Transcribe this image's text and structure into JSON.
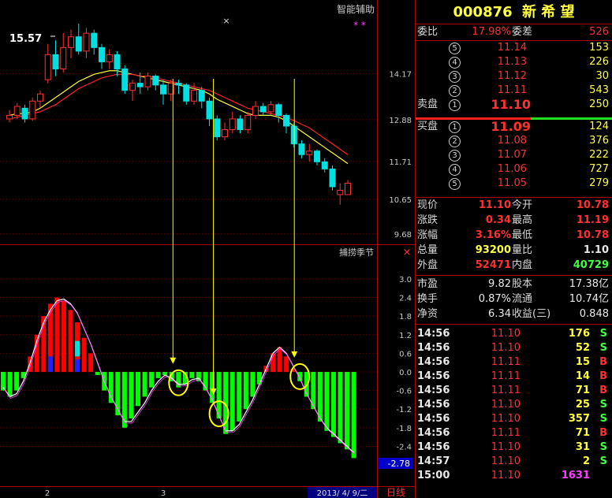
{
  "chart": {
    "indicator_title": "智能辅助",
    "sub_title": "捕捞季节",
    "high_marker": "15.57",
    "stars": "* *",
    "price_axis": [
      "14.17",
      "12.88",
      "11.71",
      "10.65",
      "9.68"
    ],
    "osc_axis": [
      "3.0",
      "2.4",
      "1.8",
      "1.2",
      "0.6",
      "0.0",
      "-0.6",
      "-1.2",
      "-1.8",
      "-2.4"
    ],
    "osc_current": "-2.78",
    "x_labels": [
      "2",
      "3"
    ],
    "date_label": "2013/ 4/ 9/二",
    "period_label": "日线",
    "close_x": "×",
    "cross_mark": "×",
    "colors": {
      "up": "#ff3030",
      "down": "#00e0e0",
      "ma1": "#ffff40",
      "ma2": "#ff2020",
      "hist_pos": "#ff0000",
      "hist_neg": "#00ff00",
      "osc_line": "#ffffff",
      "annot": "#ffff00"
    },
    "candles": [
      {
        "o": 12.9,
        "c": 13.0,
        "h": 13.15,
        "l": 12.8
      },
      {
        "o": 13.0,
        "c": 13.25,
        "h": 13.35,
        "l": 12.9
      },
      {
        "o": 13.2,
        "c": 12.9,
        "h": 13.3,
        "l": 12.8
      },
      {
        "o": 12.9,
        "c": 13.4,
        "h": 13.5,
        "l": 12.85
      },
      {
        "o": 13.4,
        "c": 13.6,
        "h": 13.7,
        "l": 13.2
      },
      {
        "o": 14.0,
        "c": 14.7,
        "h": 15.0,
        "l": 13.9
      },
      {
        "o": 14.7,
        "c": 14.3,
        "h": 15.1,
        "l": 14.1
      },
      {
        "o": 14.3,
        "c": 14.9,
        "h": 15.3,
        "l": 14.2
      },
      {
        "o": 14.9,
        "c": 15.2,
        "h": 15.4,
        "l": 14.6
      },
      {
        "o": 15.2,
        "c": 14.8,
        "h": 15.57,
        "l": 14.7
      },
      {
        "o": 14.8,
        "c": 15.3,
        "h": 15.45,
        "l": 14.6
      },
      {
        "o": 15.3,
        "c": 14.9,
        "h": 15.4,
        "l": 14.7
      },
      {
        "o": 14.9,
        "c": 14.5,
        "h": 15.0,
        "l": 14.3
      },
      {
        "o": 14.5,
        "c": 14.7,
        "h": 14.85,
        "l": 14.3
      },
      {
        "o": 14.7,
        "c": 14.3,
        "h": 14.8,
        "l": 14.1
      },
      {
        "o": 14.3,
        "c": 13.7,
        "h": 14.4,
        "l": 13.6
      },
      {
        "o": 13.7,
        "c": 13.9,
        "h": 14.0,
        "l": 13.4
      },
      {
        "o": 13.9,
        "c": 13.8,
        "h": 14.2,
        "l": 13.6
      },
      {
        "o": 13.8,
        "c": 14.1,
        "h": 14.2,
        "l": 13.7
      },
      {
        "o": 14.1,
        "c": 13.85,
        "h": 14.15,
        "l": 13.7
      },
      {
        "o": 13.85,
        "c": 13.6,
        "h": 14.0,
        "l": 13.3
      },
      {
        "o": 13.6,
        "c": 13.9,
        "h": 14.0,
        "l": 13.4
      },
      {
        "o": 13.9,
        "c": 13.85,
        "h": 14.0,
        "l": 13.6
      },
      {
        "o": 13.85,
        "c": 13.4,
        "h": 13.9,
        "l": 13.3
      },
      {
        "o": 13.4,
        "c": 13.7,
        "h": 13.9,
        "l": 13.3
      },
      {
        "o": 13.7,
        "c": 13.4,
        "h": 13.8,
        "l": 13.2
      },
      {
        "o": 13.4,
        "c": 12.9,
        "h": 13.5,
        "l": 12.7
      },
      {
        "o": 12.9,
        "c": 12.4,
        "h": 13.0,
        "l": 12.3
      },
      {
        "o": 12.4,
        "c": 12.6,
        "h": 12.8,
        "l": 12.3
      },
      {
        "o": 12.6,
        "c": 12.9,
        "h": 13.1,
        "l": 12.5
      },
      {
        "o": 12.9,
        "c": 12.6,
        "h": 13.0,
        "l": 12.5
      },
      {
        "o": 12.6,
        "c": 13.0,
        "h": 13.1,
        "l": 12.5
      },
      {
        "o": 13.0,
        "c": 13.25,
        "h": 13.4,
        "l": 12.9
      },
      {
        "o": 13.25,
        "c": 13.1,
        "h": 13.35,
        "l": 13.0
      },
      {
        "o": 13.1,
        "c": 13.3,
        "h": 13.4,
        "l": 13.0
      },
      {
        "o": 13.3,
        "c": 13.0,
        "h": 13.35,
        "l": 12.8
      },
      {
        "o": 13.0,
        "c": 12.7,
        "h": 13.05,
        "l": 12.5
      },
      {
        "o": 12.7,
        "c": 12.2,
        "h": 12.8,
        "l": 12.1
      },
      {
        "o": 12.2,
        "c": 11.9,
        "h": 12.3,
        "l": 11.8
      },
      {
        "o": 11.9,
        "c": 12.0,
        "h": 12.2,
        "l": 11.7
      },
      {
        "o": 12.0,
        "c": 11.7,
        "h": 12.05,
        "l": 11.6
      },
      {
        "o": 11.7,
        "c": 11.5,
        "h": 11.8,
        "l": 11.4
      },
      {
        "o": 11.5,
        "c": 11.0,
        "h": 11.6,
        "l": 10.9
      },
      {
        "o": 10.78,
        "c": 10.9,
        "h": 11.1,
        "l": 10.5
      },
      {
        "o": 10.78,
        "c": 11.1,
        "h": 11.19,
        "l": 10.78
      }
    ],
    "ma1": [
      13.0,
      13.05,
      13.05,
      13.1,
      13.2,
      13.35,
      13.5,
      13.65,
      13.8,
      13.95,
      14.05,
      14.15,
      14.2,
      14.25,
      14.25,
      14.2,
      14.15,
      14.1,
      14.05,
      14.0,
      13.95,
      13.9,
      13.85,
      13.8,
      13.75,
      13.7,
      13.6,
      13.45,
      13.35,
      13.25,
      13.15,
      13.05,
      13.0,
      13.0,
      13.0,
      12.95,
      12.85,
      12.7,
      12.55,
      12.4,
      12.25,
      12.1,
      11.95,
      11.8,
      11.65
    ],
    "ma2": [
      12.9,
      12.95,
      13.0,
      13.05,
      13.1,
      13.2,
      13.3,
      13.45,
      13.6,
      13.75,
      13.85,
      13.95,
      14.05,
      14.1,
      14.15,
      14.15,
      14.15,
      14.1,
      14.1,
      14.05,
      14.0,
      13.95,
      13.9,
      13.85,
      13.8,
      13.75,
      13.7,
      13.6,
      13.5,
      13.4,
      13.3,
      13.2,
      13.15,
      13.1,
      13.05,
      13.0,
      12.95,
      12.85,
      12.75,
      12.65,
      12.5,
      12.35,
      12.2,
      12.05,
      11.9
    ],
    "hist": [
      -0.6,
      -0.8,
      -0.6,
      -0.2,
      0.5,
      1.2,
      1.8,
      2.2,
      2.4,
      2.3,
      2.0,
      1.6,
      1.1,
      0.6,
      -0.1,
      -0.6,
      -1.0,
      -1.4,
      -1.8,
      -1.5,
      -1.1,
      -0.8,
      -0.5,
      -0.2,
      -0.1,
      -0.3,
      -0.5,
      -0.4,
      -0.2,
      -0.3,
      -0.6,
      -1.0,
      -1.5,
      -2.0,
      -1.9,
      -1.6,
      -1.2,
      -0.8,
      -0.4,
      0.2,
      0.6,
      0.8,
      0.5,
      0.1,
      -0.3,
      -0.8,
      -1.2,
      -1.6,
      -1.9,
      -2.1,
      -2.3,
      -2.5,
      -2.78
    ],
    "blue_bars": [
      {
        "i": 7,
        "v": 0.5
      },
      {
        "i": 11,
        "v": 0.4
      }
    ],
    "cyan_bars": [
      {
        "i": 11,
        "v": 1.0
      }
    ],
    "osc_line": [
      -0.5,
      -0.8,
      -0.7,
      -0.3,
      0.3,
      1.0,
      1.6,
      2.0,
      2.3,
      2.35,
      2.2,
      1.9,
      1.4,
      0.9,
      0.3,
      -0.3,
      -0.8,
      -1.2,
      -1.6,
      -1.6,
      -1.3,
      -1.0,
      -0.6,
      -0.3,
      -0.1,
      -0.2,
      -0.4,
      -0.4,
      -0.25,
      -0.2,
      -0.5,
      -0.9,
      -1.4,
      -1.9,
      -1.9,
      -1.7,
      -1.3,
      -0.9,
      -0.4,
      0.1,
      0.6,
      0.8,
      0.6,
      0.2,
      -0.2,
      -0.7,
      -1.1,
      -1.5,
      -1.8,
      -2.0,
      -2.2,
      -2.4,
      -2.6
    ],
    "circles": [
      {
        "i": 26
      },
      {
        "i": 32
      },
      {
        "i": 44
      }
    ]
  },
  "quote": {
    "code": "000876",
    "name": "新 希 望",
    "weibi_label": "委比",
    "weibi_value": "17.98%",
    "weicha_label": "委差",
    "weicha_value": "526",
    "sell_label": "卖盘",
    "buy_label": "买盘",
    "sells": [
      {
        "n": "5",
        "p": "11.14",
        "v": "153"
      },
      {
        "n": "4",
        "p": "11.13",
        "v": "226"
      },
      {
        "n": "3",
        "p": "11.12",
        "v": "30"
      },
      {
        "n": "2",
        "p": "11.11",
        "v": "543"
      },
      {
        "n": "1",
        "p": "11.10",
        "v": "250"
      }
    ],
    "buys": [
      {
        "n": "1",
        "p": "11.09",
        "v": "124"
      },
      {
        "n": "2",
        "p": "11.08",
        "v": "376"
      },
      {
        "n": "3",
        "p": "11.07",
        "v": "222"
      },
      {
        "n": "4",
        "p": "11.06",
        "v": "727"
      },
      {
        "n": "5",
        "p": "11.05",
        "v": "279"
      }
    ],
    "stats": [
      {
        "l1": "现价",
        "v1": "11.10",
        "c1": "red",
        "l2": "今开",
        "v2": "10.78",
        "c2": "red"
      },
      {
        "l1": "涨跌",
        "v1": "0.34",
        "c1": "red",
        "l2": "最高",
        "v2": "11.19",
        "c2": "red"
      },
      {
        "l1": "涨幅",
        "v1": "3.16%",
        "c1": "red",
        "l2": "最低",
        "v2": "10.78",
        "c2": "red"
      },
      {
        "l1": "总量",
        "v1": "93200",
        "c1": "yel",
        "l2": "量比",
        "v2": "1.10",
        "c2": "wht"
      },
      {
        "l1": "外盘",
        "v1": "52471",
        "c1": "red",
        "l2": "内盘",
        "v2": "40729",
        "c2": "grn"
      }
    ],
    "fund": [
      {
        "l1": "市盈",
        "v1": "9.82",
        "l2": "股本",
        "v2": "17.38亿"
      },
      {
        "l1": "换手",
        "v1": "0.87%",
        "l2": "流通",
        "v2": "10.74亿"
      },
      {
        "l1": "净资",
        "v1": "6.34",
        "l2": "收益(三)",
        "v2": "0.848"
      }
    ],
    "ticks": [
      {
        "t": "14:56",
        "p": "11.10",
        "v": "176",
        "s": "S"
      },
      {
        "t": "14:56",
        "p": "11.10",
        "v": "52",
        "s": "S"
      },
      {
        "t": "14:56",
        "p": "11.11",
        "v": "15",
        "s": "B"
      },
      {
        "t": "14:56",
        "p": "11.11",
        "v": "14",
        "s": "B"
      },
      {
        "t": "14:56",
        "p": "11.11",
        "v": "71",
        "s": "B"
      },
      {
        "t": "14:56",
        "p": "11.10",
        "v": "25",
        "s": "S"
      },
      {
        "t": "14:56",
        "p": "11.10",
        "v": "357",
        "s": "S"
      },
      {
        "t": "14:56",
        "p": "11.11",
        "v": "71",
        "s": "B"
      },
      {
        "t": "14:56",
        "p": "11.10",
        "v": "31",
        "s": "S"
      },
      {
        "t": "14:57",
        "p": "11.10",
        "v": "2",
        "s": "S"
      },
      {
        "t": "15:00",
        "p": "11.10",
        "v": "1631",
        "s": ""
      }
    ]
  }
}
